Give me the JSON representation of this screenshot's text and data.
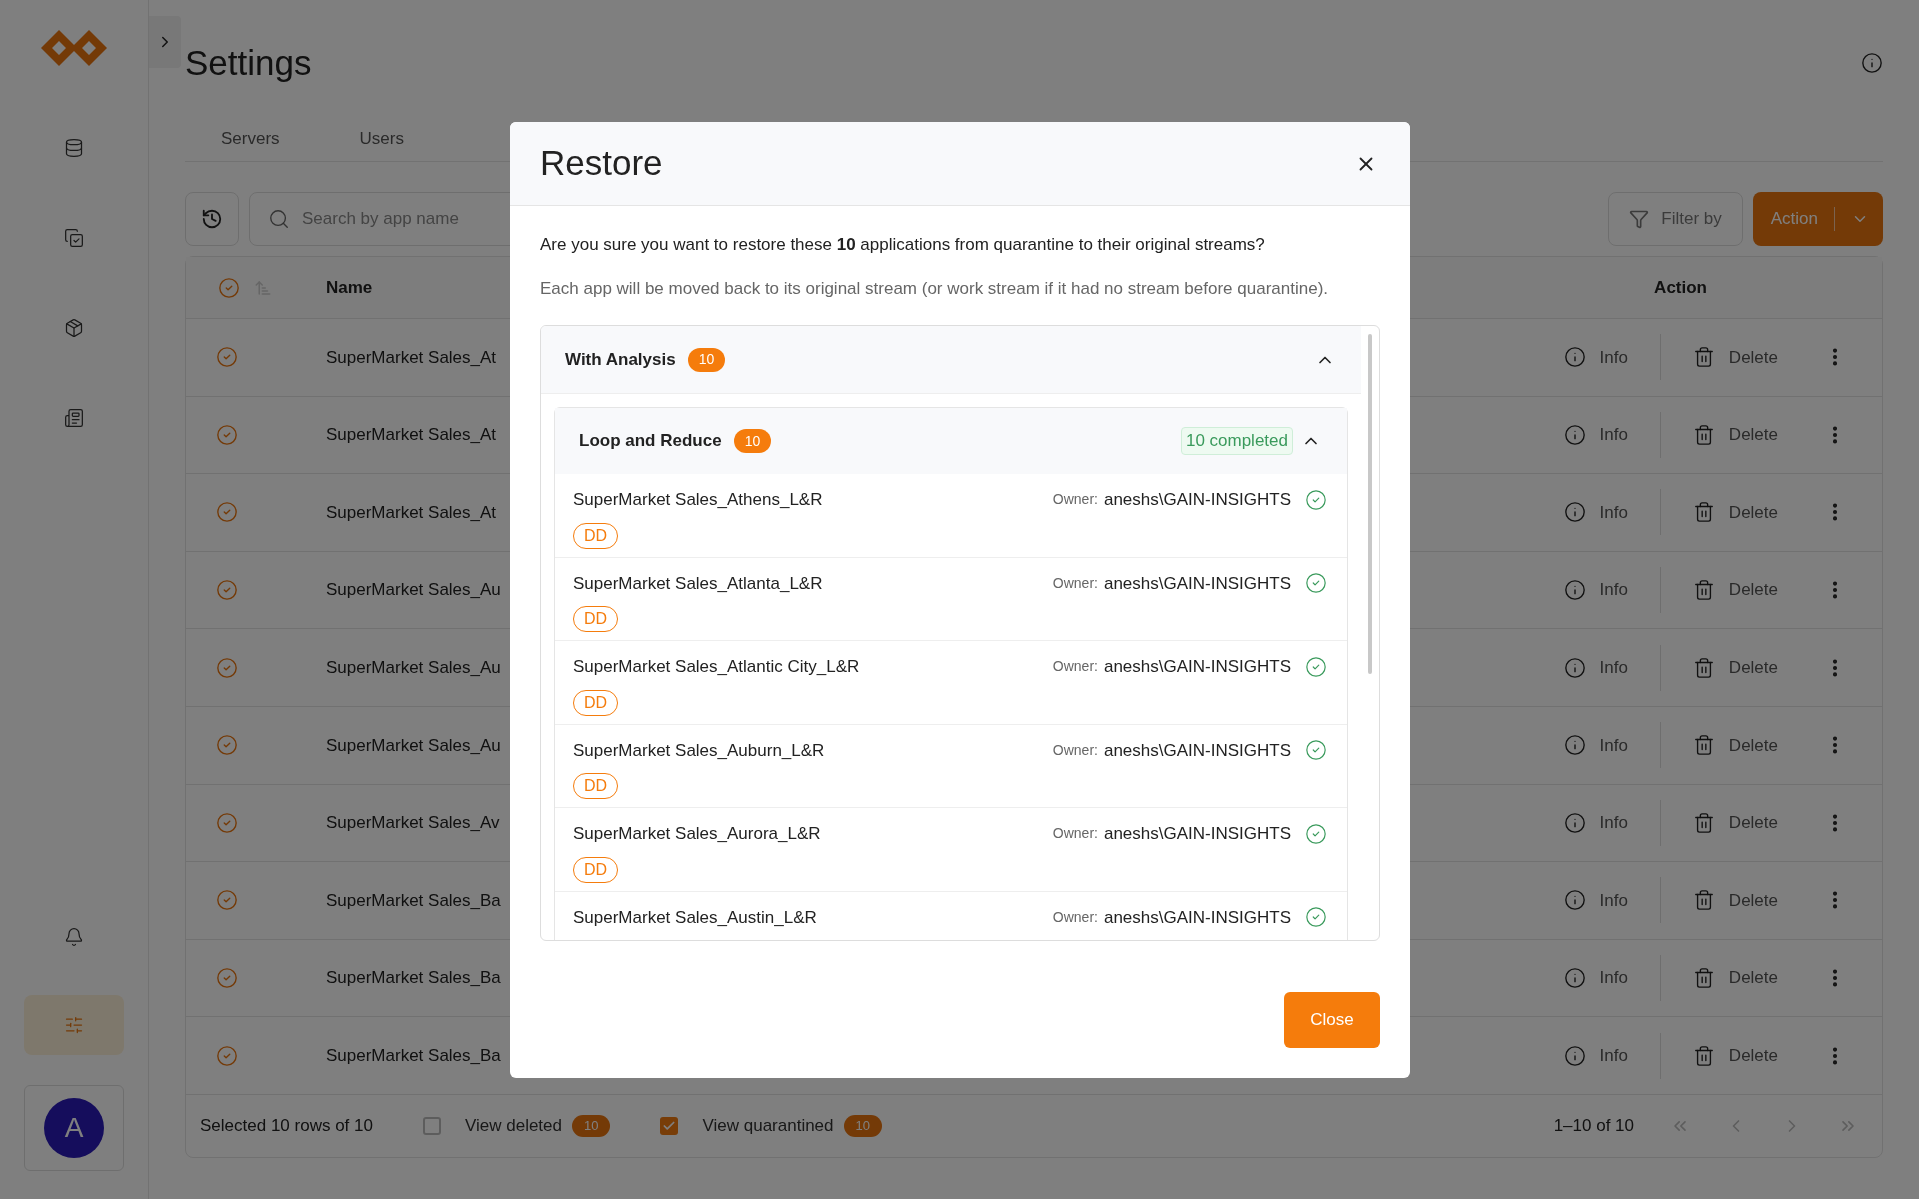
{
  "sidebar": {
    "top_items": [
      {
        "kind": "database",
        "selected": false
      },
      {
        "kind": "copy",
        "selected": false
      },
      {
        "kind": "package",
        "selected": false
      },
      {
        "kind": "report",
        "selected": false
      }
    ],
    "bottom_items": [
      {
        "kind": "bell",
        "selected": false
      },
      {
        "kind": "sliders",
        "selected": true
      }
    ],
    "avatar": {
      "initial": "A"
    }
  },
  "header": {
    "title": "Settings"
  },
  "tabs": [
    {
      "label": "Servers"
    },
    {
      "label": "Users"
    }
  ],
  "toolbar": {
    "search_placeholder": "Search by app name",
    "filter_label": "Filter by",
    "action_label": "Action"
  },
  "table": {
    "columns": [
      {
        "label": "Name"
      },
      {
        "label": "Action"
      }
    ],
    "all_selected": true,
    "rows": [
      {
        "name": "SuperMarket Sales_At",
        "selected": true,
        "info": "Info",
        "delete": "Delete"
      },
      {
        "name": "SuperMarket Sales_At",
        "selected": true,
        "info": "Info",
        "delete": "Delete"
      },
      {
        "name": "SuperMarket Sales_At",
        "selected": true,
        "info": "Info",
        "delete": "Delete"
      },
      {
        "name": "SuperMarket Sales_Au",
        "selected": true,
        "info": "Info",
        "delete": "Delete"
      },
      {
        "name": "SuperMarket Sales_Au",
        "selected": true,
        "info": "Info",
        "delete": "Delete"
      },
      {
        "name": "SuperMarket Sales_Au",
        "selected": true,
        "info": "Info",
        "delete": "Delete"
      },
      {
        "name": "SuperMarket Sales_Av",
        "selected": true,
        "info": "Info",
        "delete": "Delete"
      },
      {
        "name": "SuperMarket Sales_Ba",
        "selected": true,
        "info": "Info",
        "delete": "Delete"
      },
      {
        "name": "SuperMarket Sales_Ba",
        "selected": true,
        "info": "Info",
        "delete": "Delete"
      },
      {
        "name": "SuperMarket Sales_Ba",
        "selected": true,
        "info": "Info",
        "delete": "Delete"
      }
    ]
  },
  "footer": {
    "selection": "Selected 10 rows of 10",
    "toggles": [
      {
        "label": "View deleted",
        "checked": false,
        "count": "10"
      },
      {
        "label": "View quarantined",
        "checked": true,
        "count": "10"
      }
    ],
    "range": "1–10 of 10"
  },
  "dialog": {
    "title": "Restore",
    "message": "Are you sure you want to restore these **10** applications from quarantine to their original streams?",
    "note": "Each app will be moved back to its original stream (or work stream if it had no stream before quarantine).",
    "groups": [
      {
        "title": "With Analysis",
        "count": "10",
        "expanded": true,
        "subgroups": [
          {
            "title": "Loop and Reduce",
            "count": "10",
            "status": "10 completed",
            "expanded": true,
            "items": [
              {
                "name": "SuperMarket Sales_Athens_L&R",
                "tag": "DD",
                "owner_label": "Owner:",
                "owner": "aneshs\\GAIN-INSIGHTS",
                "done": true
              },
              {
                "name": "SuperMarket Sales_Atlanta_L&R",
                "tag": "DD",
                "owner_label": "Owner:",
                "owner": "aneshs\\GAIN-INSIGHTS",
                "done": true
              },
              {
                "name": "SuperMarket Sales_Atlantic City_L&R",
                "tag": "DD",
                "owner_label": "Owner:",
                "owner": "aneshs\\GAIN-INSIGHTS",
                "done": true
              },
              {
                "name": "SuperMarket Sales_Auburn_L&R",
                "tag": "DD",
                "owner_label": "Owner:",
                "owner": "aneshs\\GAIN-INSIGHTS",
                "done": true
              },
              {
                "name": "SuperMarket Sales_Aurora_L&R",
                "tag": "DD",
                "owner_label": "Owner:",
                "owner": "aneshs\\GAIN-INSIGHTS",
                "done": true
              },
              {
                "name": "SuperMarket Sales_Austin_L&R",
                "owner_label": "Owner:",
                "owner": "aneshs\\GAIN-INSIGHTS",
                "done": true
              }
            ]
          }
        ]
      }
    ],
    "close_label": "Close"
  }
}
